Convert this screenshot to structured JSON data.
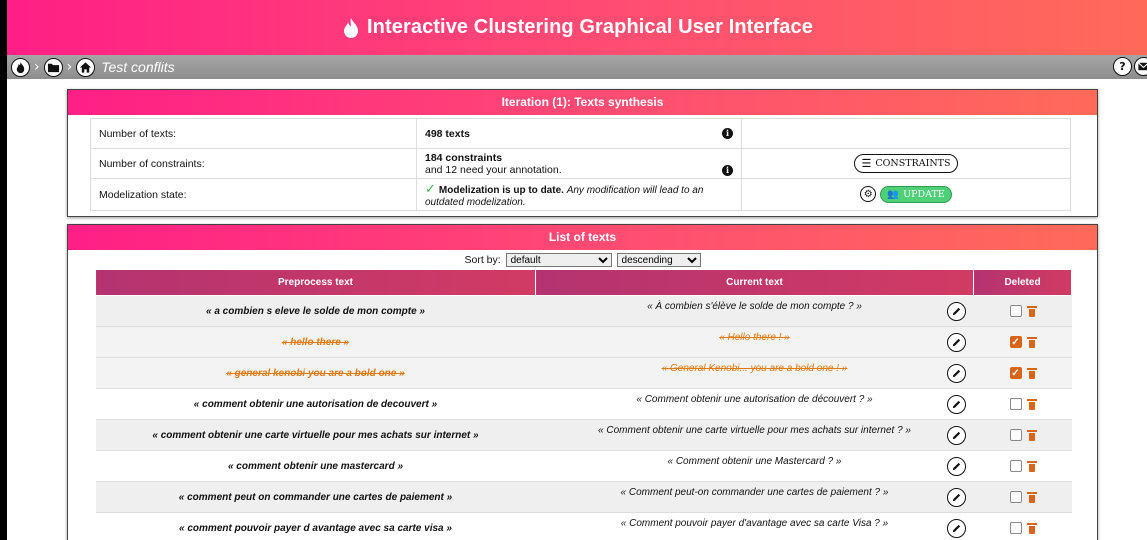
{
  "header": {
    "title": "Interactive Clustering Graphical User Interface",
    "icon": "fire-icon"
  },
  "breadcrumb": {
    "items": [
      "fire-icon",
      "folder-icon",
      "home-icon"
    ],
    "current": "Test conflits",
    "right_icons": [
      "question-icon",
      "envelope-icon"
    ]
  },
  "synthesis": {
    "title": "Iteration (1): Texts synthesis",
    "rows": {
      "texts": {
        "label": "Number of texts:",
        "value": "498 texts"
      },
      "constraints": {
        "label": "Number of constraints:",
        "value": "184 constraints",
        "sub": "and 12 need your annotation.",
        "button": "CONSTRAINTS"
      },
      "modelization": {
        "label": "Modelization state:",
        "status": "Modelization is up to date.",
        "note": "Any modification will lead to an outdated modelization.",
        "button": "UPDATE"
      }
    }
  },
  "texts_list": {
    "title": "List of texts",
    "sort_label": "Sort by:",
    "sort_by": "default",
    "sort_order": "descending",
    "columns": [
      "Preprocess text",
      "Current text",
      "Deleted"
    ],
    "rows": [
      {
        "pre": "« a combien s eleve le solde de mon compte »",
        "cur": "« À combien s'élève le solde de mon compte ? »",
        "deleted": false
      },
      {
        "pre": "« hello there »",
        "cur": "« Hello there ! »",
        "deleted": true
      },
      {
        "pre": "« general kenobi you are a bold one »",
        "cur": "« General Kenobi... you are a bold one ! »",
        "deleted": true
      },
      {
        "pre": "« comment obtenir une autorisation de decouvert »",
        "cur": "« Comment obtenir une autorisation de découvert ? »",
        "deleted": false
      },
      {
        "pre": "« comment obtenir une carte virtuelle pour mes achats sur internet »",
        "cur": "« Comment obtenir une carte virtuelle pour mes achats sur internet ? »",
        "deleted": false
      },
      {
        "pre": "« comment obtenir une mastercard »",
        "cur": "« Comment obtenir une Mastercard ? »",
        "deleted": false
      },
      {
        "pre": "« comment peut on commander une cartes de paiement »",
        "cur": "« Comment peut-on commander une cartes de paiement ? »",
        "deleted": false
      },
      {
        "pre": "« comment pouvoir payer d avantage avec sa carte visa »",
        "cur": "« Comment pouvoir payer d'avantage avec sa carte Visa ? »",
        "deleted": false
      }
    ]
  }
}
